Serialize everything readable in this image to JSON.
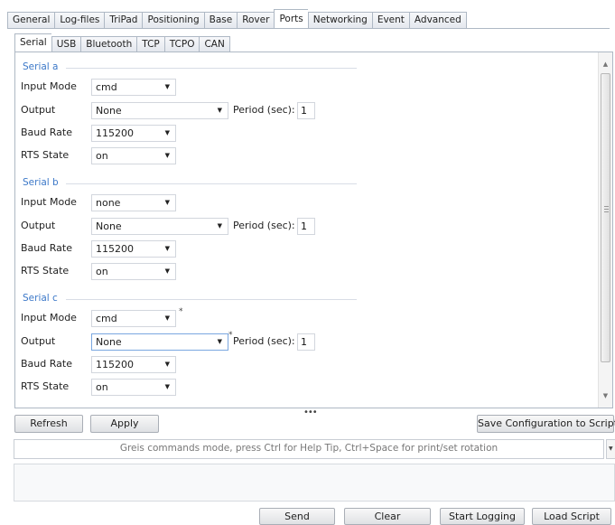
{
  "main_tabs": [
    {
      "label": "General"
    },
    {
      "label": "Log-files"
    },
    {
      "label": "TriPad"
    },
    {
      "label": "Positioning"
    },
    {
      "label": "Base"
    },
    {
      "label": "Rover"
    },
    {
      "label": "Ports",
      "active": true
    },
    {
      "label": "Networking"
    },
    {
      "label": "Event"
    },
    {
      "label": "Advanced"
    }
  ],
  "sub_tabs": [
    {
      "label": "Serial",
      "active": true
    },
    {
      "label": "USB"
    },
    {
      "label": "Bluetooth"
    },
    {
      "label": "TCP"
    },
    {
      "label": "TCPO"
    },
    {
      "label": "CAN"
    }
  ],
  "field_labels": {
    "input_mode": "Input Mode",
    "output": "Output",
    "baud_rate": "Baud Rate",
    "rts_state": "RTS State",
    "period": "Period (sec):"
  },
  "serial_groups": [
    {
      "title": "Serial a",
      "input_mode": "cmd",
      "output": "None",
      "period": "1",
      "baud_rate": "115200",
      "rts_state": "on"
    },
    {
      "title": "Serial b",
      "input_mode": "none",
      "output": "None",
      "period": "1",
      "baud_rate": "115200",
      "rts_state": "on"
    },
    {
      "title": "Serial c",
      "input_mode": "cmd",
      "output": "None",
      "period": "1",
      "baud_rate": "115200",
      "rts_state": "on",
      "modified_marker": "*"
    }
  ],
  "buttons": {
    "refresh": "Refresh",
    "apply": "Apply",
    "save_config": "Save Configuration to Script",
    "send": "Send",
    "clear": "Clear",
    "start_logging": "Start Logging",
    "load_script": "Load Script"
  },
  "splitter_glyph": "•••",
  "command": {
    "placeholder": "Greis commands mode, press Ctrl for Help Tip, Ctrl+Space for print/set rotation"
  },
  "icons": {
    "dropdown": "▼",
    "scroll_up": "▲",
    "scroll_down": "▼"
  }
}
